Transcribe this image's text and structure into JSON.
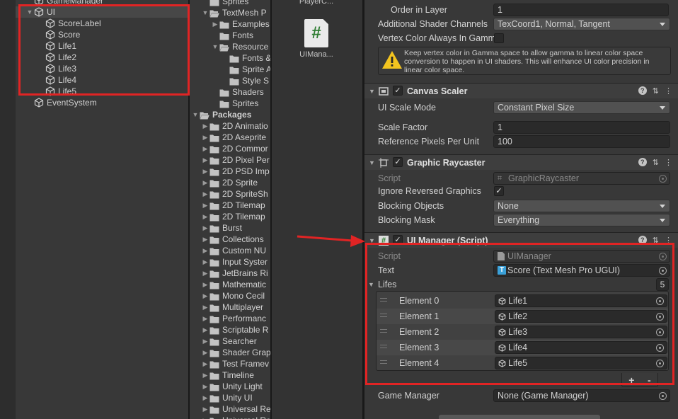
{
  "hierarchy": {
    "items": [
      {
        "label": "GameManager",
        "depth": 1,
        "arrow": ""
      },
      {
        "label": "UI",
        "depth": 1,
        "arrow": "▼"
      },
      {
        "label": "ScoreLabel",
        "depth": 2,
        "arrow": ""
      },
      {
        "label": "Score",
        "depth": 2,
        "arrow": ""
      },
      {
        "label": "Life1",
        "depth": 2,
        "arrow": ""
      },
      {
        "label": "Life2",
        "depth": 2,
        "arrow": ""
      },
      {
        "label": "Life3",
        "depth": 2,
        "arrow": ""
      },
      {
        "label": "Life4",
        "depth": 2,
        "arrow": ""
      },
      {
        "label": "Life5",
        "depth": 2,
        "arrow": ""
      },
      {
        "label": "EventSystem",
        "depth": 1,
        "arrow": ""
      }
    ]
  },
  "project": {
    "items": [
      {
        "label": "Sprites",
        "depth": 1,
        "arrow": "",
        "open": false
      },
      {
        "label": "TextMesh P",
        "depth": 1,
        "arrow": "▼",
        "open": true
      },
      {
        "label": "Examples",
        "depth": 2,
        "arrow": "▶",
        "open": false
      },
      {
        "label": "Fonts",
        "depth": 2,
        "arrow": "",
        "open": false
      },
      {
        "label": "Resource",
        "depth": 2,
        "arrow": "▼",
        "open": true
      },
      {
        "label": "Fonts &",
        "depth": 3,
        "arrow": "",
        "open": false
      },
      {
        "label": "Sprite A",
        "depth": 3,
        "arrow": "",
        "open": false
      },
      {
        "label": "Style S",
        "depth": 3,
        "arrow": "",
        "open": false
      },
      {
        "label": "Shaders",
        "depth": 2,
        "arrow": "",
        "open": false
      },
      {
        "label": "Sprites",
        "depth": 2,
        "arrow": "",
        "open": false
      },
      {
        "label": "Packages",
        "depth": 0,
        "arrow": "▼",
        "open": true,
        "bold": true
      },
      {
        "label": "2D Animatio",
        "depth": 1,
        "arrow": "▶",
        "open": false
      },
      {
        "label": "2D Aseprite",
        "depth": 1,
        "arrow": "▶",
        "open": false
      },
      {
        "label": "2D Commor",
        "depth": 1,
        "arrow": "▶",
        "open": false
      },
      {
        "label": "2D Pixel Per",
        "depth": 1,
        "arrow": "▶",
        "open": false
      },
      {
        "label": "2D PSD Imp",
        "depth": 1,
        "arrow": "▶",
        "open": false
      },
      {
        "label": "2D Sprite",
        "depth": 1,
        "arrow": "▶",
        "open": false
      },
      {
        "label": "2D SpriteSh",
        "depth": 1,
        "arrow": "▶",
        "open": false
      },
      {
        "label": "2D Tilemap",
        "depth": 1,
        "arrow": "▶",
        "open": false
      },
      {
        "label": "2D Tilemap",
        "depth": 1,
        "arrow": "▶",
        "open": false
      },
      {
        "label": "Burst",
        "depth": 1,
        "arrow": "▶",
        "open": false
      },
      {
        "label": "Collections",
        "depth": 1,
        "arrow": "▶",
        "open": false
      },
      {
        "label": "Custom NU",
        "depth": 1,
        "arrow": "▶",
        "open": false
      },
      {
        "label": "Input Syster",
        "depth": 1,
        "arrow": "▶",
        "open": false
      },
      {
        "label": "JetBrains Ri",
        "depth": 1,
        "arrow": "▶",
        "open": false
      },
      {
        "label": "Mathematic",
        "depth": 1,
        "arrow": "▶",
        "open": false
      },
      {
        "label": "Mono Cecil",
        "depth": 1,
        "arrow": "▶",
        "open": false
      },
      {
        "label": "Multiplayer",
        "depth": 1,
        "arrow": "▶",
        "open": false
      },
      {
        "label": "Performanc",
        "depth": 1,
        "arrow": "▶",
        "open": false
      },
      {
        "label": "Scriptable R",
        "depth": 1,
        "arrow": "▶",
        "open": false
      },
      {
        "label": "Searcher",
        "depth": 1,
        "arrow": "▶",
        "open": false
      },
      {
        "label": "Shader Grap",
        "depth": 1,
        "arrow": "▶",
        "open": false
      },
      {
        "label": "Test Framev",
        "depth": 1,
        "arrow": "▶",
        "open": false
      },
      {
        "label": "Timeline",
        "depth": 1,
        "arrow": "▶",
        "open": false
      },
      {
        "label": "Unity Light",
        "depth": 1,
        "arrow": "▶",
        "open": false
      },
      {
        "label": "Unity UI",
        "depth": 1,
        "arrow": "▶",
        "open": false
      },
      {
        "label": "Universal Re",
        "depth": 1,
        "arrow": "▶",
        "open": false
      },
      {
        "label": "Universal Re",
        "depth": 1,
        "arrow": "▶",
        "open": false
      }
    ]
  },
  "assets": {
    "player_label": "PlayerC...",
    "uimanager_label": "UIMana...",
    "uimanager_glyph": "#"
  },
  "canvas": {
    "order_in_layer_label": "Order in Layer",
    "order_in_layer_value": "1",
    "shader_channels_label": "Additional Shader Channels",
    "shader_channels_value": "TexCoord1, Normal, Tangent",
    "vertex_color_label": "Vertex Color Always In Gamm",
    "warning_text": "Keep vertex color in Gamma space to allow gamma to linear color space conversion to happen in UI shaders. This will enhance UI color precision in linear color space."
  },
  "canvas_scaler": {
    "title": "Canvas Scaler",
    "scale_mode_label": "UI Scale Mode",
    "scale_mode_value": "Constant Pixel Size",
    "scale_factor_label": "Scale Factor",
    "scale_factor_value": "1",
    "ref_ppu_label": "Reference Pixels Per Unit",
    "ref_ppu_value": "100"
  },
  "graphic_raycaster": {
    "title": "Graphic Raycaster",
    "script_label": "Script",
    "script_value": "GraphicRaycaster",
    "ignore_reversed_label": "Ignore Reversed Graphics",
    "blocking_objects_label": "Blocking Objects",
    "blocking_objects_value": "None",
    "blocking_mask_label": "Blocking Mask",
    "blocking_mask_value": "Everything"
  },
  "ui_manager": {
    "title": "UI Manager (Script)",
    "script_label": "Script",
    "script_value": "UIManager",
    "text_label": "Text",
    "text_badge": "T",
    "text_value": "Score (Text Mesh Pro UGUI)",
    "lifes_label": "Lifes",
    "lifes_count": "5",
    "elements": [
      {
        "label": "Element 0",
        "value": "Life1"
      },
      {
        "label": "Element 1",
        "value": "Life2"
      },
      {
        "label": "Element 2",
        "value": "Life3"
      },
      {
        "label": "Element 3",
        "value": "Life4"
      },
      {
        "label": "Element 4",
        "value": "Life5"
      }
    ],
    "plus": "+",
    "minus": "-",
    "game_manager_label": "Game Manager",
    "game_manager_value": "None (Game Manager)"
  },
  "colors": {
    "annotation_red": "#e12424",
    "script_green": "#2f7d32",
    "tmp_blue": "#3aa0d8"
  }
}
